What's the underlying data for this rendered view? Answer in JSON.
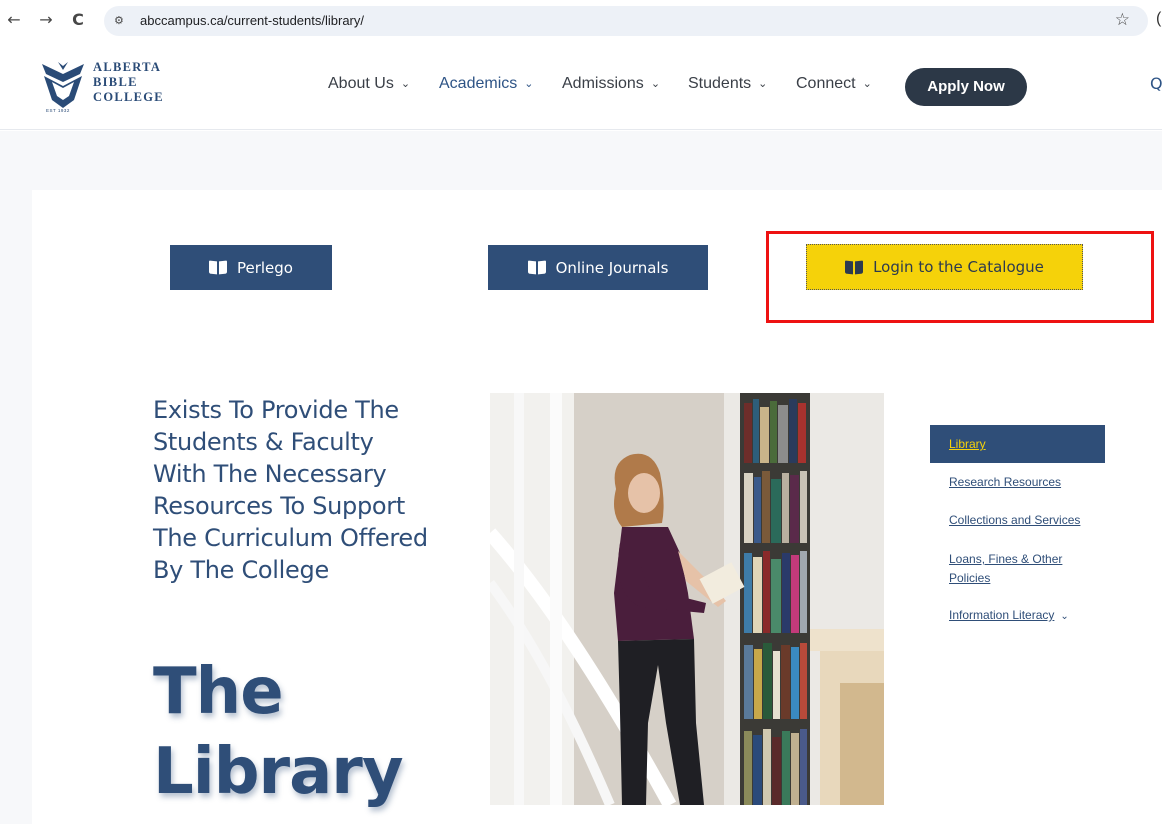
{
  "browser": {
    "back_icon": "←",
    "forward_icon": "→",
    "reload_icon": "C",
    "url": "abccampus.ca/current-students/library/",
    "star_icon": "☆"
  },
  "logo": {
    "line1": "ALBERTA",
    "line2": "BIBLE",
    "line3": "COLLEGE",
    "est": "EST 1932"
  },
  "nav": {
    "items": [
      {
        "label": "About Us"
      },
      {
        "label": "Academics"
      },
      {
        "label": "Admissions"
      },
      {
        "label": "Students"
      },
      {
        "label": "Connect"
      }
    ],
    "chevron": "⌄",
    "apply_label": "Apply Now",
    "search_glyph": "Q"
  },
  "buttons": {
    "perlego": "Perlego",
    "journals": "Online Journals",
    "catalogue": "Login to the Catalogue"
  },
  "hero": {
    "tagline": "Exists To Provide The Students & Faculty With The Necessary Resources To Support The Curriculum Offered By The College",
    "title_line1": "The",
    "title_line2": "Library"
  },
  "side_menu": {
    "items": [
      {
        "label": "Library"
      },
      {
        "label": "Research Resources"
      },
      {
        "label": "Collections and Services"
      },
      {
        "label": "Loans, Fines & Other Policies"
      },
      {
        "label": "Information Literacy"
      }
    ],
    "chevron": "⌄"
  },
  "colors": {
    "brand_blue": "#2f4e78",
    "accent_yellow": "#f5d20a",
    "apply_dark": "#2c3847",
    "highlight_red": "#ee1111"
  }
}
